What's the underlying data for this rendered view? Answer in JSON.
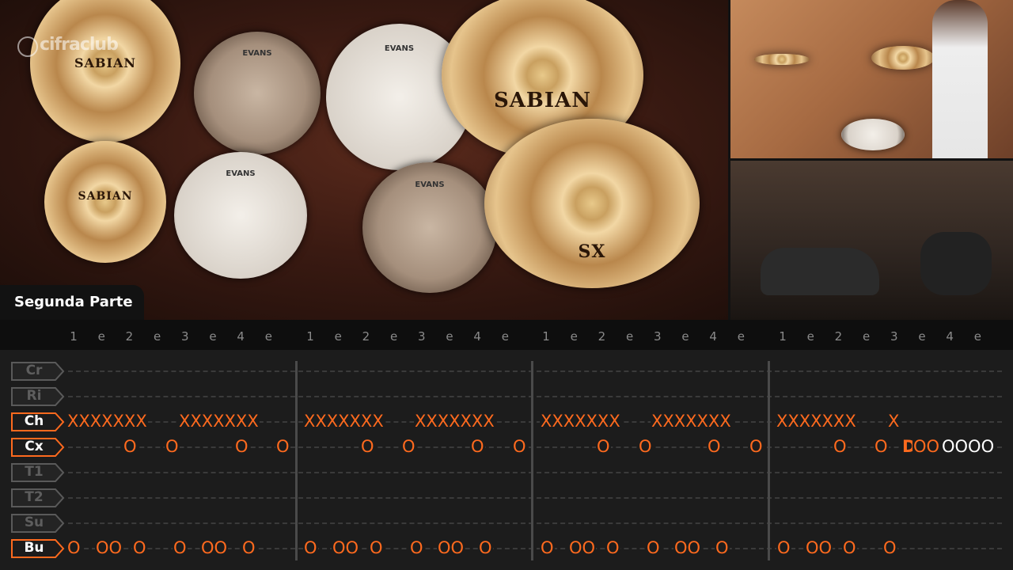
{
  "section": {
    "label": "Segunda Parte"
  },
  "brands": {
    "cymbal": "SABIAN",
    "cymbal_series": "SX",
    "drumhead": "EVANS",
    "logo": "cifraclub"
  },
  "beat_labels": [
    "1",
    "e",
    "2",
    "e",
    "3",
    "e",
    "4",
    "e"
  ],
  "rows": [
    {
      "id": "Cr",
      "label": "Cr",
      "active": false
    },
    {
      "id": "Ri",
      "label": "Ri",
      "active": false
    },
    {
      "id": "Ch",
      "label": "Ch",
      "active": true
    },
    {
      "id": "Cx",
      "label": "Cx",
      "active": true
    },
    {
      "id": "T1",
      "label": "T1",
      "active": false
    },
    {
      "id": "T2",
      "label": "T2",
      "active": false
    },
    {
      "id": "Su",
      "label": "Su",
      "active": false
    },
    {
      "id": "Bu",
      "label": "Bu",
      "active": true
    }
  ],
  "tab": {
    "ch": [
      "XXXXXXX",
      "XXXXXXX",
      "XXXXXXX",
      "XXXXXXX",
      "XXXXXXX",
      "XXXXXXX",
      "XXXXXXX",
      "X"
    ],
    "cx": [
      "O",
      "O",
      "O",
      "O",
      "O",
      "O",
      "O",
      "O",
      "O",
      "O",
      "O",
      "O",
      "O",
      "O"
    ],
    "cx_current": "D",
    "cx_highlight": "OO",
    "cx_upcoming": "OOOO",
    "bu": [
      "O",
      "OO",
      "O",
      "O",
      "OO",
      "O"
    ]
  },
  "colors": {
    "accent": "#ff6a1e",
    "inactive": "#5a5a5a",
    "background": "#1c1c1c"
  }
}
